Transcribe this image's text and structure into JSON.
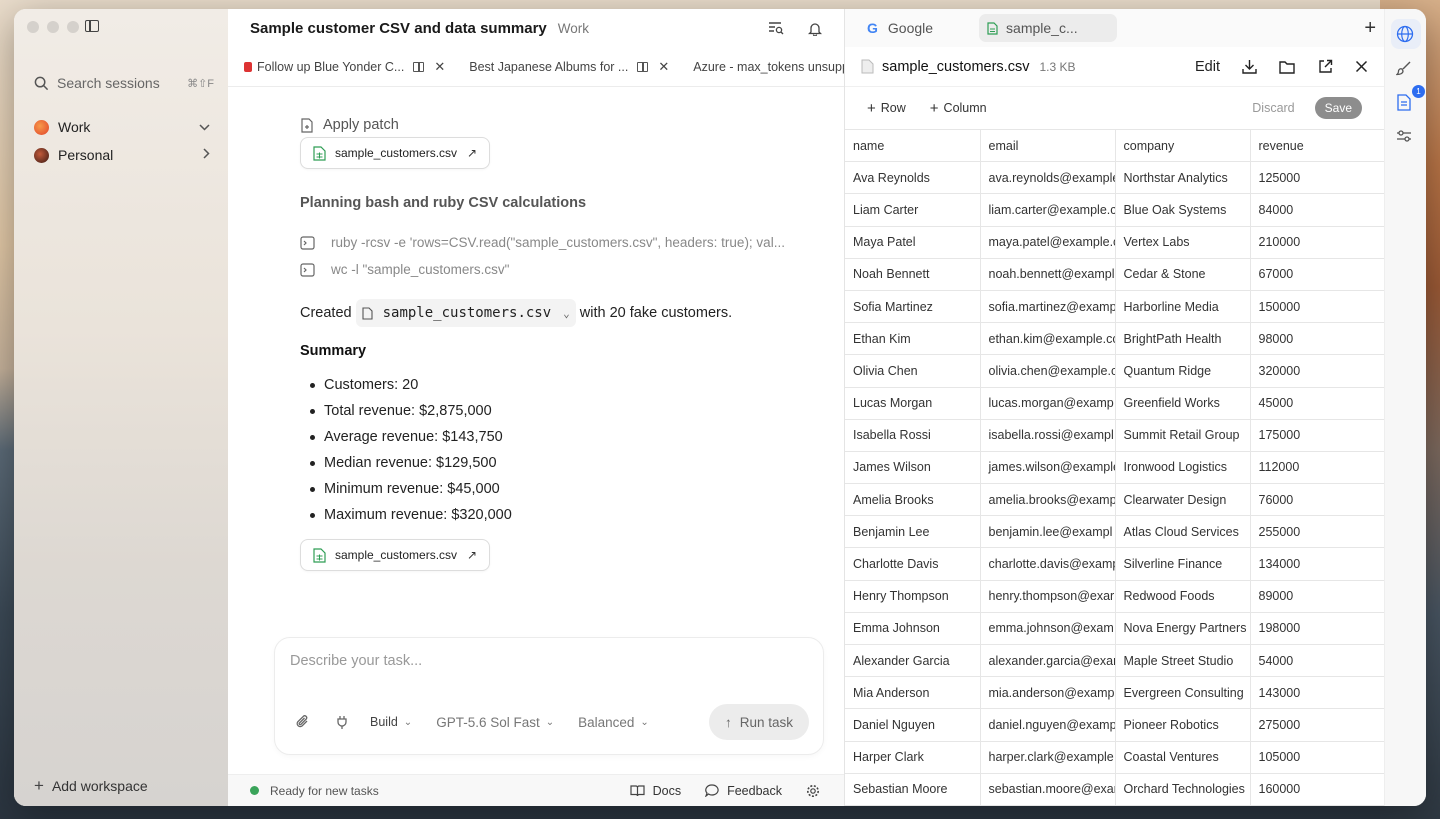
{
  "sidebar": {
    "search_placeholder": "Search sessions",
    "search_shortcut": "⌘⇧F",
    "workspaces": [
      {
        "label": "Work",
        "color": "#e8502f",
        "expanded": true
      },
      {
        "label": "Personal",
        "color": "#7a2a20",
        "expanded": false
      }
    ],
    "add_workspace": "Add workspace"
  },
  "main": {
    "title": "Sample customer CSV and data summary",
    "workspace": "Work",
    "tabs": [
      {
        "label": "Follow up Blue Yonder C..."
      },
      {
        "label": "Best Japanese Albums for ..."
      },
      {
        "label": "Azure - max_tokens unsupp..."
      }
    ],
    "apply_patch": "Apply patch",
    "file_chip": "sample_customers.csv",
    "planning_heading": "Planning bash and ruby CSV calculations",
    "commands": [
      "ruby -rcsv -e 'rows=CSV.read(\"sample_customers.csv\", headers: true); val...",
      "wc -l \"sample_customers.csv\""
    ],
    "created_prefix": "Created",
    "created_file": "sample_customers.csv",
    "created_suffix": "with 20 fake customers.",
    "summary_heading": "Summary",
    "summary_items": [
      "Customers: 20",
      "Total revenue: $2,875,000",
      "Average revenue: $143,750",
      "Median revenue: $129,500",
      "Minimum revenue: $45,000",
      "Maximum revenue: $320,000"
    ],
    "file_chip_2": "sample_customers.csv"
  },
  "composer": {
    "placeholder": "Describe your task...",
    "mode": "Build",
    "model": "GPT-5.6 Sol Fast",
    "effort": "Balanced",
    "run_label": "Run task"
  },
  "status": {
    "text": "Ready for new tasks",
    "docs": "Docs",
    "feedback": "Feedback"
  },
  "panel": {
    "tab_google": "Google",
    "tab_file": "sample_c...",
    "file_name": "sample_customers.csv",
    "file_size": "1.3 KB",
    "edit_label": "Edit",
    "add_row": "Row",
    "add_column": "Column",
    "discard": "Discard",
    "save": "Save",
    "columns": [
      "name",
      "email",
      "company",
      "revenue"
    ],
    "rows": [
      [
        "Ava Reynolds",
        "ava.reynolds@example",
        "Northstar Analytics",
        "125000"
      ],
      [
        "Liam Carter",
        "liam.carter@example.c",
        "Blue Oak Systems",
        "84000"
      ],
      [
        "Maya Patel",
        "maya.patel@example.c",
        "Vertex Labs",
        "210000"
      ],
      [
        "Noah Bennett",
        "noah.bennett@exampl",
        "Cedar & Stone",
        "67000"
      ],
      [
        "Sofia Martinez",
        "sofia.martinez@examp",
        "Harborline Media",
        "150000"
      ],
      [
        "Ethan Kim",
        "ethan.kim@example.cc",
        "BrightPath Health",
        "98000"
      ],
      [
        "Olivia Chen",
        "olivia.chen@example.c",
        "Quantum Ridge",
        "320000"
      ],
      [
        "Lucas Morgan",
        "lucas.morgan@examp",
        "Greenfield Works",
        "45000"
      ],
      [
        "Isabella Rossi",
        "isabella.rossi@exampl",
        "Summit Retail Group",
        "175000"
      ],
      [
        "James Wilson",
        "james.wilson@example",
        "Ironwood Logistics",
        "112000"
      ],
      [
        "Amelia Brooks",
        "amelia.brooks@examp",
        "Clearwater Design",
        "76000"
      ],
      [
        "Benjamin Lee",
        "benjamin.lee@exampl",
        "Atlas Cloud Services",
        "255000"
      ],
      [
        "Charlotte Davis",
        "charlotte.davis@examp",
        "Silverline Finance",
        "134000"
      ],
      [
        "Henry Thompson",
        "henry.thompson@exar",
        "Redwood Foods",
        "89000"
      ],
      [
        "Emma Johnson",
        "emma.johnson@exam",
        "Nova Energy Partners",
        "198000"
      ],
      [
        "Alexander Garcia",
        "alexander.garcia@exar",
        "Maple Street Studio",
        "54000"
      ],
      [
        "Mia Anderson",
        "mia.anderson@examp",
        "Evergreen Consulting",
        "143000"
      ],
      [
        "Daniel Nguyen",
        "daniel.nguyen@examp",
        "Pioneer Robotics",
        "275000"
      ],
      [
        "Harper Clark",
        "harper.clark@example",
        "Coastal Ventures",
        "105000"
      ],
      [
        "Sebastian Moore",
        "sebastian.moore@exar",
        "Orchard Technologies",
        "160000"
      ]
    ]
  },
  "rail": {
    "badge": "1"
  }
}
